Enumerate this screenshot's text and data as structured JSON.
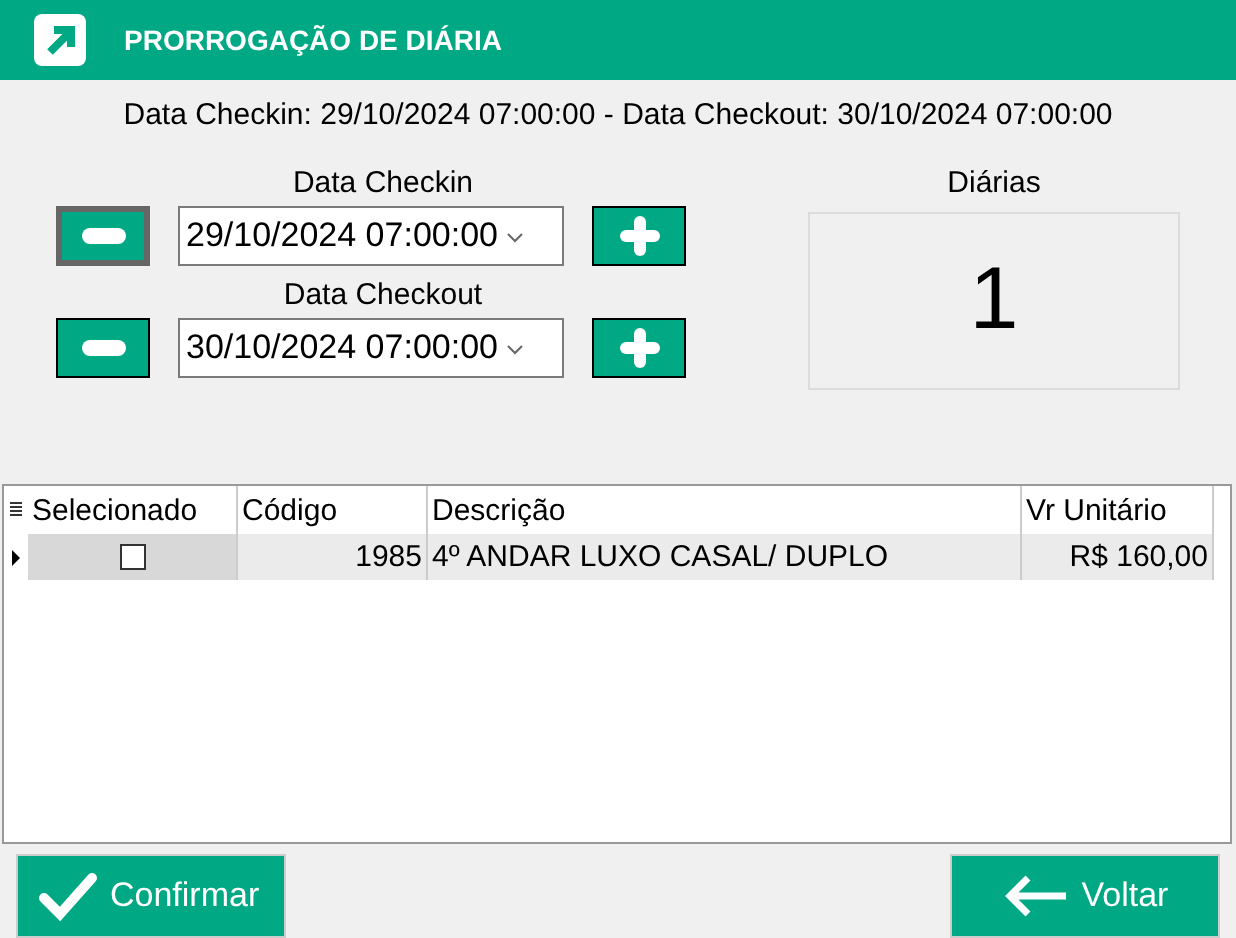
{
  "window": {
    "title": "PRORROGAÇÃO DE DIÁRIA"
  },
  "summary": "Data Checkin: 29/10/2024 07:00:00 - Data Checkout: 30/10/2024 07:00:00",
  "dates": [
    {
      "label": "Data Checkin",
      "value": "29/10/2024 07:00:00",
      "focused": true
    },
    {
      "label": "Data Checkout",
      "value": "30/10/2024 07:00:00",
      "focused": false
    }
  ],
  "diarias": {
    "label": "Diárias",
    "value": "1"
  },
  "table": {
    "columns": [
      "Selecionado",
      "Código",
      "Descrição",
      "Vr Unitário"
    ],
    "rows": [
      {
        "checked": false,
        "current": true,
        "codigo": "1985",
        "descricao": "4º ANDAR LUXO CASAL/ DUPLO",
        "valor": "R$ 160,00"
      }
    ]
  },
  "buttons": [
    {
      "kind": "confirm",
      "label": "Confirmar"
    },
    {
      "kind": "back",
      "label": "Voltar"
    }
  ]
}
